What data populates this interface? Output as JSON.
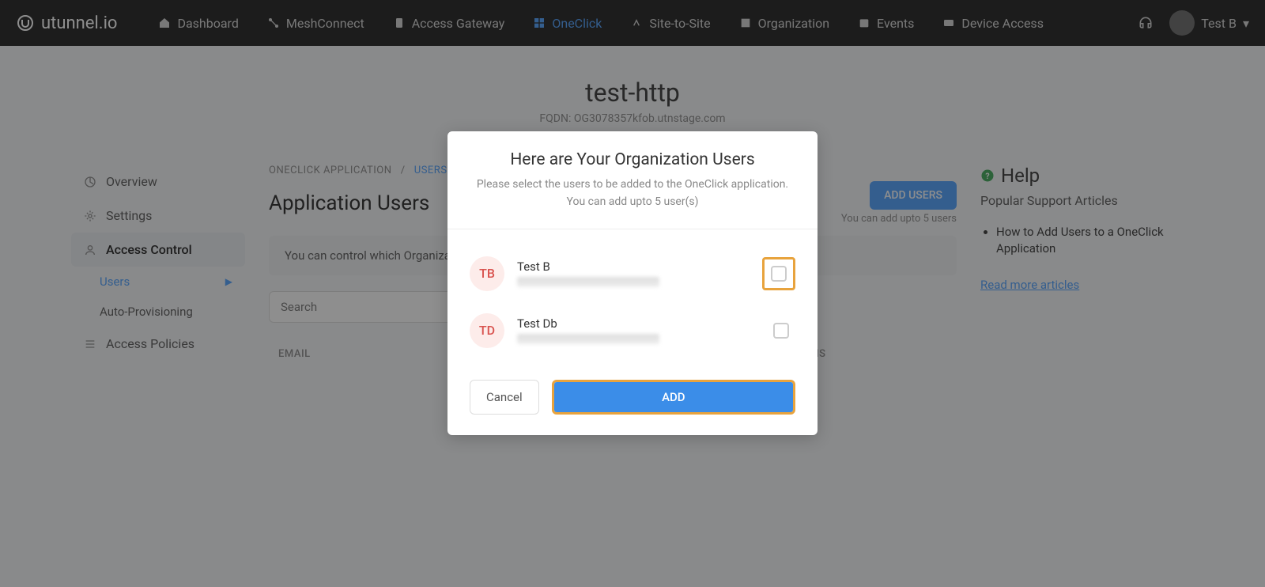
{
  "brand": {
    "name": "utunnel.io"
  },
  "nav": {
    "items": [
      {
        "label": "Dashboard"
      },
      {
        "label": "MeshConnect"
      },
      {
        "label": "Access Gateway"
      },
      {
        "label": "OneClick"
      },
      {
        "label": "Site-to-Site"
      },
      {
        "label": "Organization"
      },
      {
        "label": "Events"
      },
      {
        "label": "Device Access"
      }
    ],
    "user": "Test B"
  },
  "page": {
    "title": "test-http",
    "fqdn_label": "FQDN: OG3078357kfob.utnstage.com"
  },
  "sidebar": {
    "overview": "Overview",
    "settings": "Settings",
    "access_control": "Access Control",
    "users": "Users",
    "auto_provisioning": "Auto-Provisioning",
    "access_policies": "Access Policies"
  },
  "content": {
    "breadcrumb_app": "ONECLICK APPLICATION",
    "breadcrumb_sep": "/",
    "breadcrumb_current": "USERS",
    "title": "Application Users",
    "add_users_btn": "ADD USERS",
    "add_users_note": "You can add upto 5 users",
    "info_banner": "You can control which Organization users have access to this application.",
    "search_placeholder": "Search",
    "col_email": "EMAIL",
    "col_actions": "ACTIONS"
  },
  "help": {
    "title": "Help",
    "subtitle": "Popular Support Articles",
    "articles": [
      "How to Add Users to a OneClick Application"
    ],
    "read_more": "Read more articles"
  },
  "modal": {
    "title": "Here are Your Organization Users",
    "line1": "Please select the users to be added to the OneClick application.",
    "line2": "You can add upto 5 user(s)",
    "users": [
      {
        "initials": "TB",
        "name": "Test B",
        "highlighted": true
      },
      {
        "initials": "TD",
        "name": "Test Db",
        "highlighted": false
      }
    ],
    "cancel": "Cancel",
    "add": "ADD"
  }
}
